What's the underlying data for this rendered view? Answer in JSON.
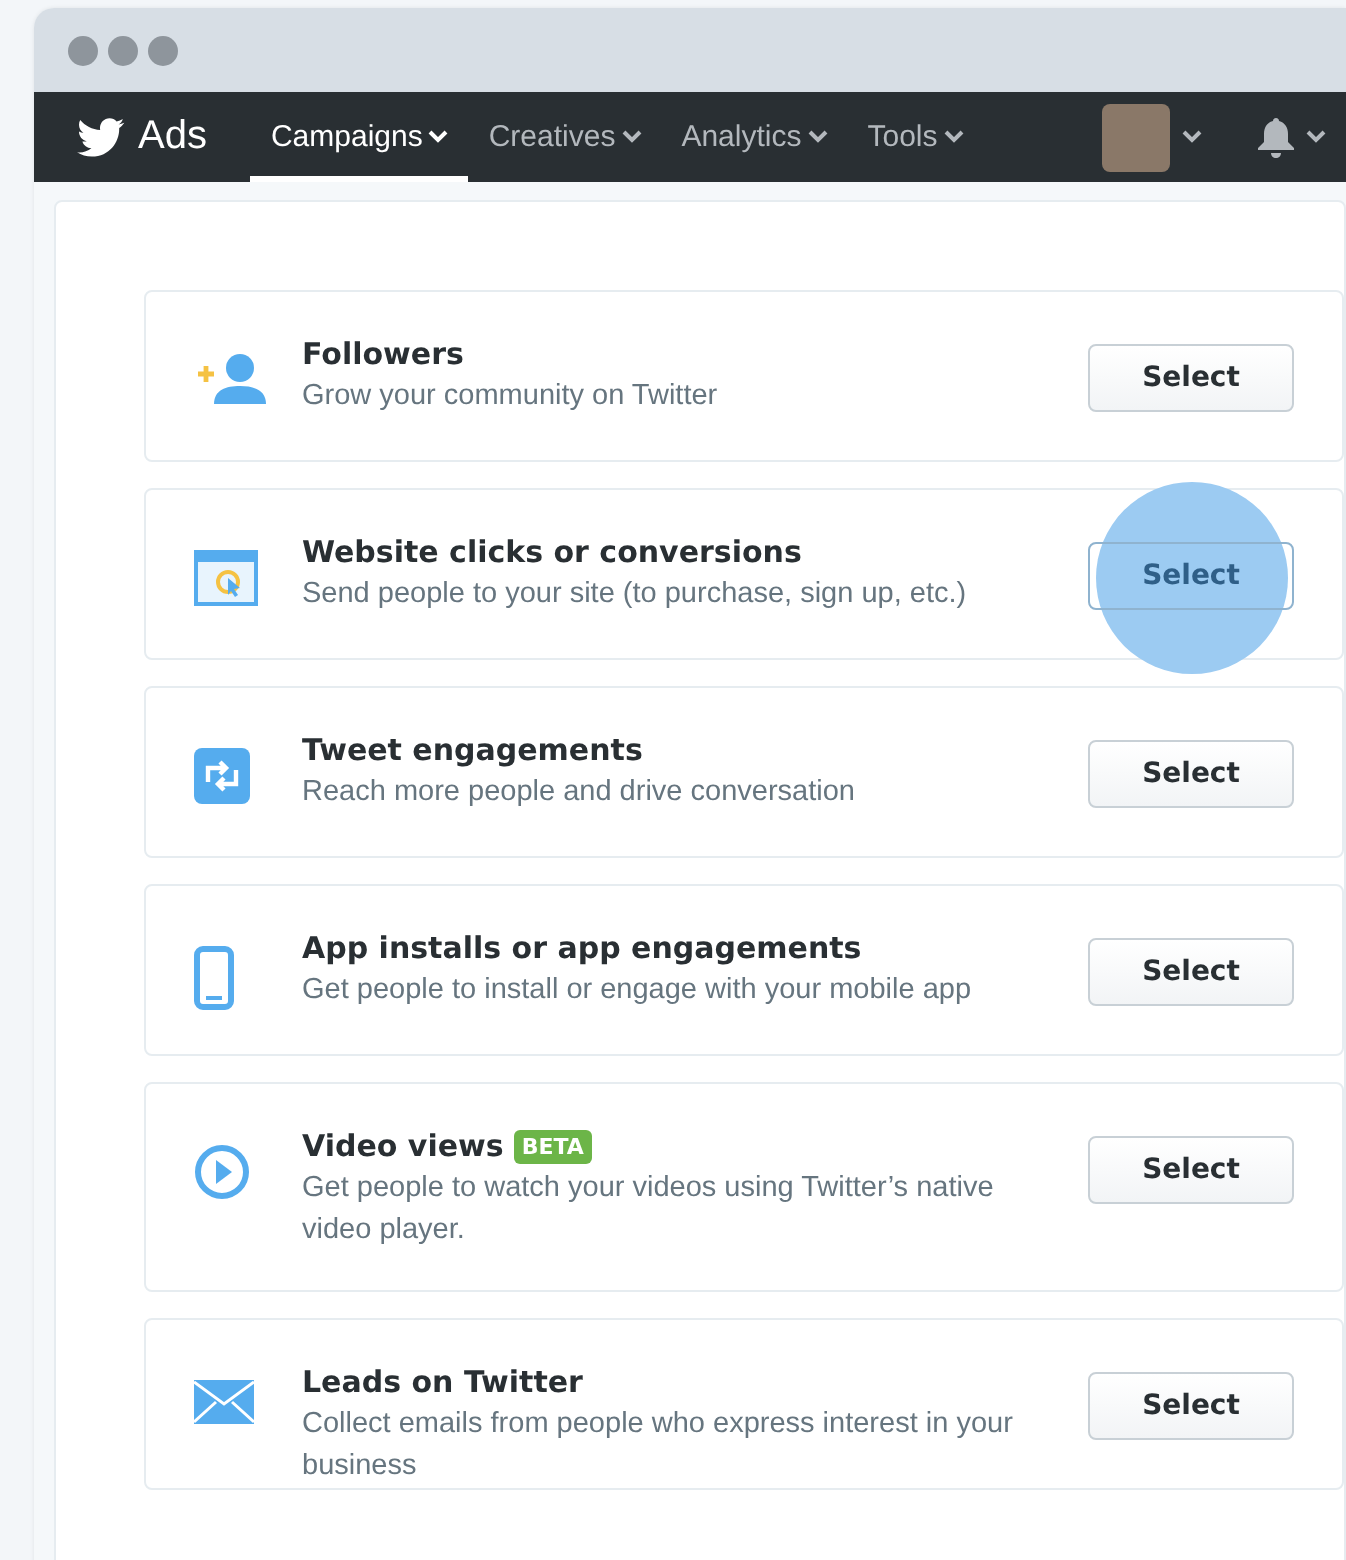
{
  "nav": {
    "brand": "Ads",
    "tabs": [
      {
        "label": "Campaigns",
        "selected": true
      },
      {
        "label": "Creatives",
        "selected": false
      },
      {
        "label": "Analytics",
        "selected": false
      },
      {
        "label": "Tools",
        "selected": false
      }
    ]
  },
  "objectives": [
    {
      "kind": "followers",
      "title": "Followers",
      "description": "Grow your community on Twitter",
      "button": "Select",
      "touched": false
    },
    {
      "kind": "website",
      "title": "Website clicks or conversions",
      "description": "Send people to your site (to purchase, sign up, etc.)",
      "button": "Select",
      "touched": true
    },
    {
      "kind": "engagement",
      "title": "Tweet engagements",
      "description": "Reach more people and drive conversation",
      "button": "Select",
      "touched": false
    },
    {
      "kind": "app",
      "title": "App installs or app engagements",
      "description": "Get people to install or engage with your mobile app",
      "button": "Select",
      "touched": false
    },
    {
      "kind": "video",
      "title": "Video views",
      "badge": "BETA",
      "description": "Get people to watch your videos using Twitter’s native video player.",
      "button": "Select",
      "touched": false
    },
    {
      "kind": "leads",
      "title": "Leads on Twitter",
      "description": "Collect emails from people who express interest in your business",
      "button": "Select",
      "touched": false
    }
  ]
}
